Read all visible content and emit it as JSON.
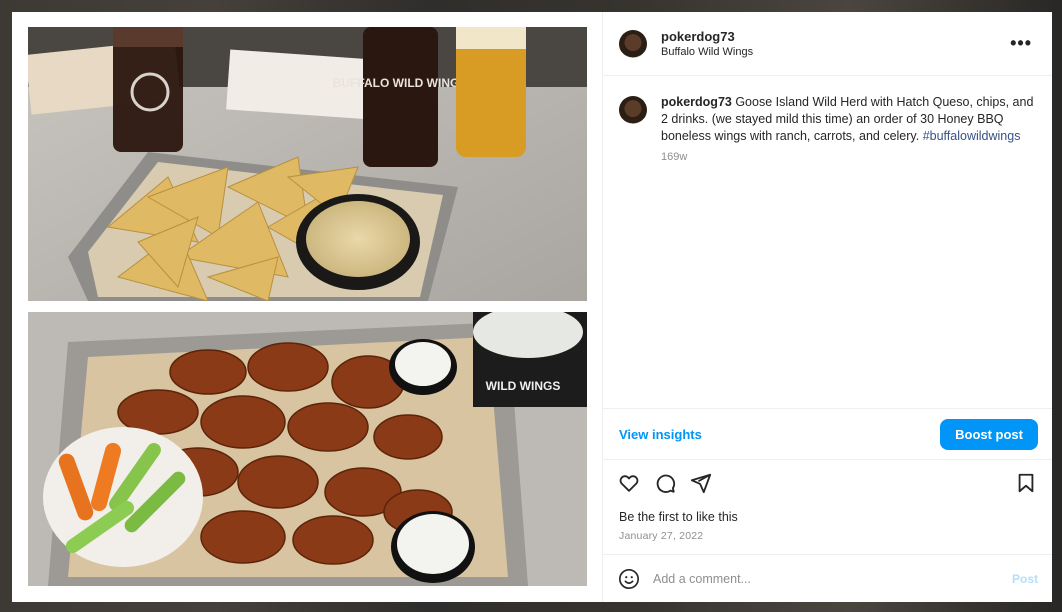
{
  "post": {
    "username": "pokerdog73",
    "location": "Buffalo Wild Wings",
    "caption_user": "pokerdog73",
    "caption_text": " Goose Island Wild Herd with Hatch Queso, chips, and 2 drinks. (we stayed mild this time) an order of 30 Honey BBQ boneless wings with ranch, carrots, and celery. ",
    "hashtag": "#buffalowildwings",
    "age": "169w",
    "likes_text": "Be the first to like this",
    "date": "January 27, 2022",
    "more_label": "•••"
  },
  "insights": {
    "view_label": "View insights",
    "boost_label": "Boost post"
  },
  "comment_box": {
    "placeholder": "Add a comment...",
    "post_label": "Post"
  },
  "icons": {
    "like": "heart-icon",
    "comment": "comment-icon",
    "share": "share-icon",
    "save": "bookmark-icon",
    "emoji": "emoji-icon",
    "more": "more-options-icon"
  },
  "photo_labels": {
    "cup_text": "BUFFALO WILD WINGS",
    "cup_text_2": "WILD WINGS"
  },
  "colors": {
    "accent": "#0095f6",
    "hashtag": "#385185",
    "muted": "#8e8e8e"
  }
}
